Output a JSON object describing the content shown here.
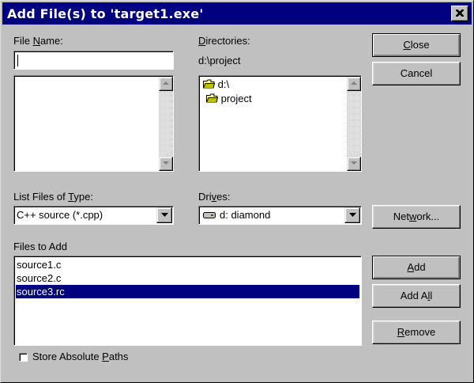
{
  "window": {
    "title": "Add File(s) to 'target1.exe'"
  },
  "file_name": {
    "label_pre": "File ",
    "label_key": "N",
    "label_post": "ame:",
    "value": ""
  },
  "directories": {
    "label_key": "D",
    "label_post": "irectories:",
    "current_path": "d:\\project",
    "items": [
      {
        "label": "d:\\",
        "icon": "open-folder-icon"
      },
      {
        "label": "project",
        "icon": "open-folder-icon"
      }
    ]
  },
  "file_type": {
    "label_pre": "List Files of ",
    "label_key": "T",
    "label_post": "ype:",
    "selected": "C++ source (*.cpp)"
  },
  "drives": {
    "label_pre": "Dri",
    "label_key": "v",
    "label_post": "es:",
    "selected": "d: diamond",
    "icon": "drive-icon"
  },
  "files_to_add": {
    "label": "Files to Add",
    "items": [
      "source1.c",
      "source2.c",
      "source3.rc"
    ],
    "selected_index": 2
  },
  "store_paths": {
    "label_pre": "Store Absolute ",
    "label_key": "P",
    "label_post": "aths",
    "checked": false
  },
  "buttons": {
    "close": {
      "key": "C",
      "rest": "lose"
    },
    "cancel": {
      "label": "Cancel"
    },
    "network": {
      "pre": "Net",
      "key": "w",
      "post": "ork..."
    },
    "add": {
      "key": "A",
      "rest": "dd"
    },
    "add_all": {
      "pre": "Add A",
      "key": "l",
      "post": "l"
    },
    "remove": {
      "key": "R",
      "rest": "emove"
    }
  },
  "colors": {
    "title_bar": "#000080",
    "selection": "#000080",
    "face": "#c0c0c0"
  }
}
